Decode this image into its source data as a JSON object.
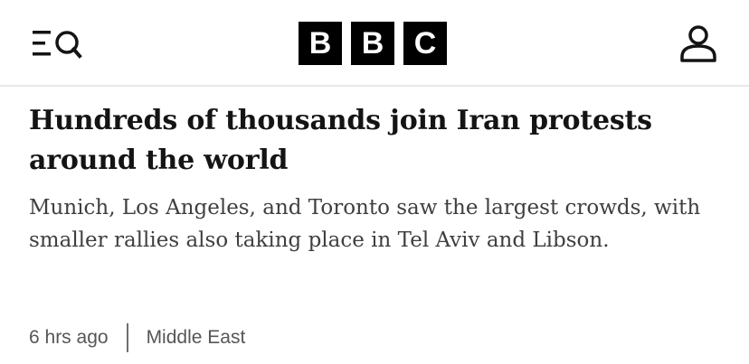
{
  "header": {
    "logo_letters": [
      "B",
      "B",
      "C"
    ],
    "menu_icon": "menu-search-icon",
    "account_icon": "user-icon"
  },
  "article": {
    "headline": "Hundreds of thousands join Iran protests around the world",
    "summary": "Munich, Los Angeles, and Toronto saw the largest crowds, with smaller rallies also taking place in Tel Aviv and Libson.",
    "timestamp": "6 hrs ago",
    "topic": "Middle East"
  },
  "colors": {
    "text": "#141414",
    "summary": "#3f3f42",
    "meta": "#545658",
    "logo_bg": "#000000",
    "border": "#e6e8ea"
  }
}
